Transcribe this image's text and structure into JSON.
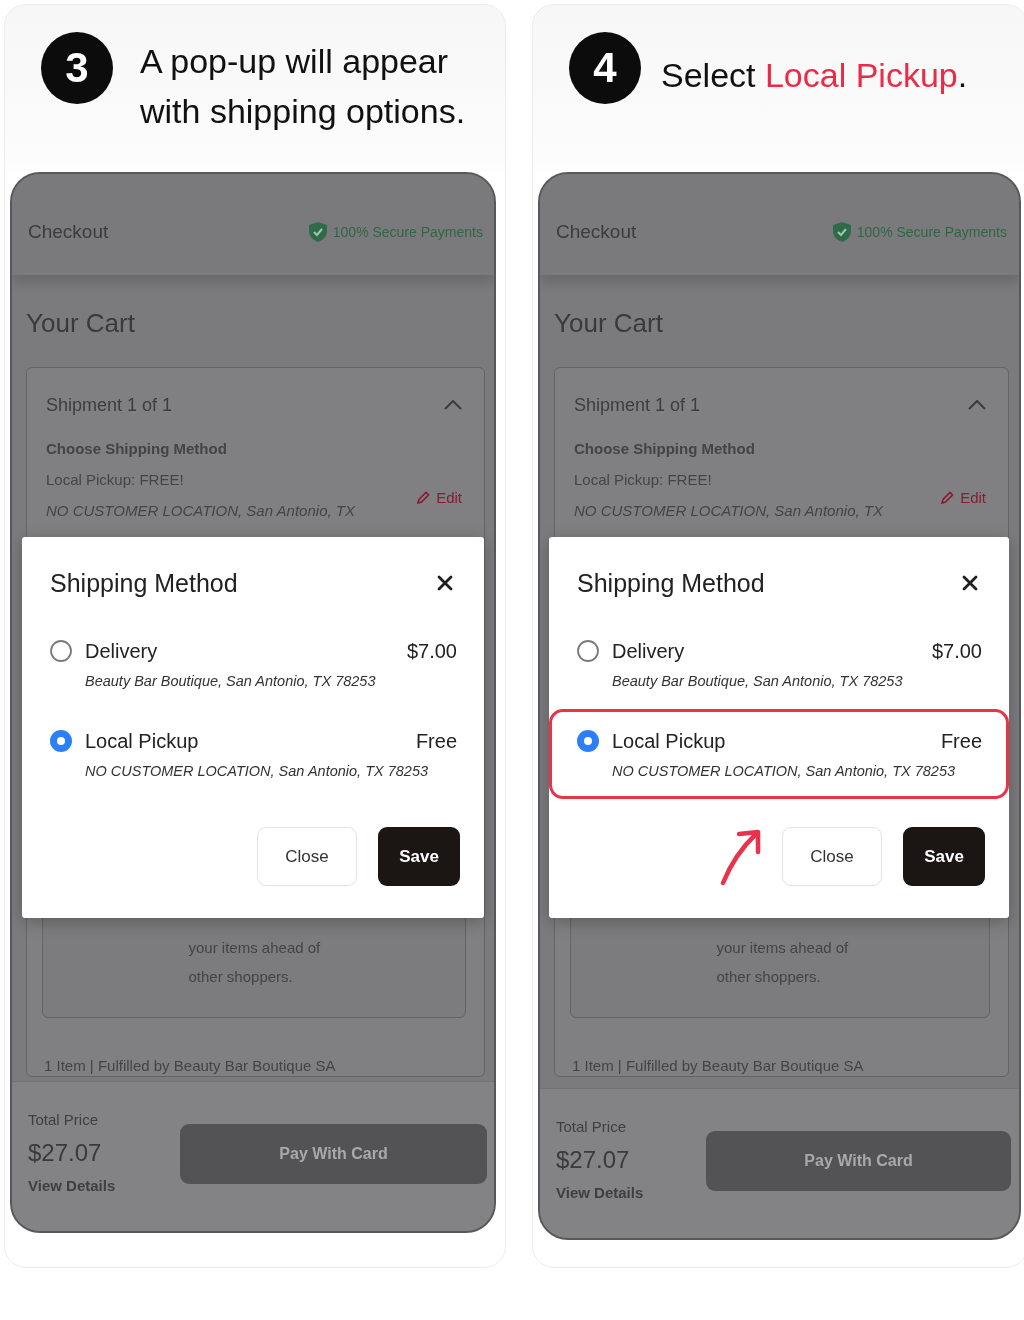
{
  "panels": [
    {
      "step": "3",
      "instruction": [
        {
          "text": "A pop-up will appear with shipping options.",
          "highlight": false
        }
      ],
      "checkout": {
        "title": "Checkout",
        "secure_badge": "100% Secure Payments",
        "cart_title": "Your Cart",
        "shipment": {
          "title": "Shipment 1 of 1",
          "expanded": true,
          "method_heading": "Choose Shipping Method",
          "method": "Local Pickup: FREE!",
          "address": "NO CUSTOMER LOCATION, San Antonio, TX",
          "edit_link": "Edit"
        },
        "pickup_note_lines": [
          "your items ahead of",
          "other shoppers."
        ],
        "fulfillment": "1 Item | Fulfilled by Beauty Bar Boutique SA",
        "footer": {
          "total_label": "Total Price",
          "total": "$27.07",
          "details_link": "View Details",
          "pay_button": "Pay With Card"
        }
      },
      "modal": {
        "title": "Shipping Method",
        "options": [
          {
            "label": "Delivery",
            "price": "$7.00",
            "address": "Beauty Bar Boutique, San Antonio, TX 78253",
            "selected": false,
            "highlighted": false
          },
          {
            "label": "Local Pickup",
            "price": "Free",
            "address": "NO CUSTOMER LOCATION, San Antonio, TX 78253",
            "selected": true,
            "highlighted": false
          }
        ],
        "buttons": [
          {
            "label": "Close",
            "kind": "secondary"
          },
          {
            "label": "Save",
            "kind": "primary"
          }
        ]
      },
      "pointer_arrow": false
    },
    {
      "step": "4",
      "instruction": [
        {
          "text": "Select ",
          "highlight": false
        },
        {
          "text": "Local Pickup",
          "highlight": true
        },
        {
          "text": ".",
          "highlight": false
        }
      ],
      "checkout": {
        "title": "Checkout",
        "secure_badge": "100% Secure Payments",
        "cart_title": "Your Cart",
        "shipment": {
          "title": "Shipment 1 of 1",
          "expanded": true,
          "method_heading": "Choose Shipping Method",
          "method": "Local Pickup: FREE!",
          "address": "NO CUSTOMER LOCATION, San Antonio, TX",
          "edit_link": "Edit"
        },
        "pickup_note_lines": [
          "your items ahead of",
          "other shoppers."
        ],
        "fulfillment": "1 Item | Fulfilled by Beauty Bar Boutique SA",
        "footer": {
          "total_label": "Total Price",
          "total": "$27.07",
          "details_link": "View Details",
          "pay_button": "Pay With Card"
        }
      },
      "modal": {
        "title": "Shipping Method",
        "options": [
          {
            "label": "Delivery",
            "price": "$7.00",
            "address": "Beauty Bar Boutique, San Antonio, TX 78253",
            "selected": false,
            "highlighted": false
          },
          {
            "label": "Local Pickup",
            "price": "Free",
            "address": "NO CUSTOMER LOCATION, San Antonio, TX 78253",
            "selected": true,
            "highlighted": true
          }
        ],
        "buttons": [
          {
            "label": "Close",
            "kind": "secondary"
          },
          {
            "label": "Save",
            "kind": "primary"
          }
        ]
      },
      "pointer_arrow": true
    }
  ]
}
